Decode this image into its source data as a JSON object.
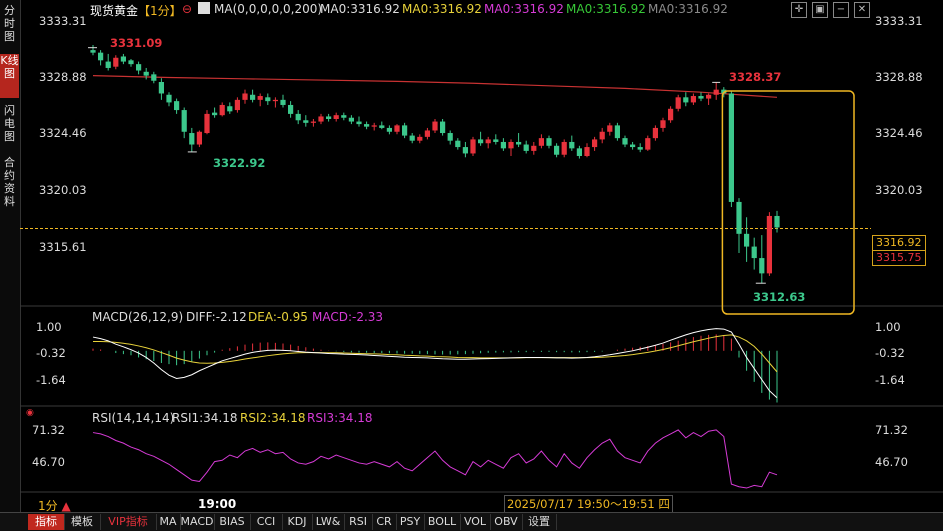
{
  "sidebar": {
    "items": [
      {
        "label": "分时图",
        "active": false
      },
      {
        "label": "K线图",
        "active": true
      },
      {
        "label": "闪电图",
        "active": false
      },
      {
        "label": "合约资料",
        "active": false
      }
    ]
  },
  "header": {
    "title": "现货黄金",
    "period": "【1分】",
    "collapse_icon": "circle-minus-icon",
    "ma_params": "MA(0,0,0,0,0,200)",
    "ma_values": [
      {
        "text": "MA0:3316.92",
        "color": "#dddddd"
      },
      {
        "text": "MA0:3316.92",
        "color": "#e8d23a"
      },
      {
        "text": "MA0:3316.92",
        "color": "#d63bd6"
      },
      {
        "text": "MA0:3316.92",
        "color": "#37c837"
      },
      {
        "text": "MA0:3316.92",
        "color": "#8a8a8a"
      }
    ],
    "tools": [
      "cross-icon",
      "frame-icon",
      "minus-icon",
      "close-icon"
    ]
  },
  "price_axis": [
    "3333.31",
    "3328.88",
    "3324.46",
    "3320.03",
    "3315.61"
  ],
  "price_tags": {
    "current": "3316.92",
    "second": "3315.75"
  },
  "annotations": {
    "high_left": "3331.09",
    "low_left": "3322.92",
    "high_right": "3328.37",
    "low_right": "3312.63"
  },
  "macd": {
    "label": "MACD(26,12,9)",
    "diff": "DIFF:-2.12",
    "dea": "DEA:-0.95",
    "macd": "MACD:-2.33",
    "axis": [
      "1.00",
      "-0.32",
      "-1.64"
    ]
  },
  "rsi": {
    "label": "RSI(14,14,14)",
    "rsi1": "RSI1:34.18",
    "rsi2": "RSI2:34.18",
    "rsi3": "RSI3:34.18",
    "axis": [
      "71.32",
      "46.70"
    ]
  },
  "footer": {
    "period_label": "1分",
    "time_label": "19:00",
    "range_label": "2025/07/17 19:50～19:51 四"
  },
  "bottom_tabs": [
    "指标",
    "模板",
    "VIP指标",
    "MA",
    "MACD",
    "BIAS",
    "CCI",
    "KDJ",
    "LW&",
    "RSI",
    "CR",
    "PSY",
    "BOLL",
    "VOL",
    "OBV",
    "设置"
  ],
  "colors": {
    "up": "#e8323c",
    "down": "#3cc88c",
    "highlight": "#f0b823",
    "ma200": "#c83232",
    "dea": "#e8d23a",
    "rsi": "#d63bd6"
  },
  "chart_data": {
    "type": "candlestick",
    "price_range": [
      3311.0,
      3334.2
    ],
    "candles": [
      [
        3330.9,
        3331.3,
        3330.5,
        3330.7
      ],
      [
        3330.7,
        3330.9,
        3329.7,
        3330.1
      ],
      [
        3330.0,
        3330.6,
        3329.3,
        3329.5
      ],
      [
        3329.6,
        3330.5,
        3329.4,
        3330.3
      ],
      [
        3330.4,
        3330.6,
        3329.8,
        3330.0
      ],
      [
        3330.1,
        3330.2,
        3329.6,
        3329.8
      ],
      [
        3329.8,
        3330.0,
        3329.0,
        3329.3
      ],
      [
        3329.2,
        3329.5,
        3328.6,
        3328.9
      ],
      [
        3329.0,
        3329.2,
        3328.3,
        3328.5
      ],
      [
        3328.4,
        3328.7,
        3327.0,
        3327.5
      ],
      [
        3327.4,
        3327.6,
        3326.5,
        3326.8
      ],
      [
        3326.9,
        3327.1,
        3325.9,
        3326.2
      ],
      [
        3326.2,
        3326.4,
        3324.0,
        3324.5
      ],
      [
        3324.4,
        3324.8,
        3322.9,
        3323.5
      ],
      [
        3323.5,
        3324.6,
        3323.3,
        3324.5
      ],
      [
        3324.4,
        3326.2,
        3324.3,
        3325.9
      ],
      [
        3326.0,
        3326.4,
        3325.6,
        3325.8
      ],
      [
        3325.8,
        3326.8,
        3325.7,
        3326.6
      ],
      [
        3326.5,
        3326.8,
        3325.9,
        3326.1
      ],
      [
        3326.2,
        3327.2,
        3326.0,
        3327.0
      ],
      [
        3327.0,
        3327.8,
        3326.7,
        3327.5
      ],
      [
        3327.4,
        3327.8,
        3326.8,
        3327.0
      ],
      [
        3327.0,
        3327.5,
        3326.5,
        3327.3
      ],
      [
        3327.2,
        3327.5,
        3326.6,
        3326.9
      ],
      [
        3326.9,
        3327.2,
        3326.4,
        3327.0
      ],
      [
        3327.0,
        3327.4,
        3326.4,
        3326.6
      ],
      [
        3326.6,
        3326.9,
        3325.6,
        3325.9
      ],
      [
        3325.9,
        3326.2,
        3325.1,
        3325.4
      ],
      [
        3325.4,
        3325.8,
        3324.9,
        3325.2
      ],
      [
        3325.2,
        3325.5,
        3324.9,
        3325.3
      ],
      [
        3325.3,
        3325.9,
        3325.1,
        3325.7
      ],
      [
        3325.7,
        3325.9,
        3325.3,
        3325.5
      ],
      [
        3325.5,
        3326.0,
        3325.3,
        3325.8
      ],
      [
        3325.8,
        3326.0,
        3325.4,
        3325.6
      ],
      [
        3325.6,
        3325.8,
        3325.1,
        3325.3
      ],
      [
        3325.3,
        3325.7,
        3324.9,
        3325.1
      ],
      [
        3325.1,
        3325.3,
        3324.7,
        3324.9
      ],
      [
        3324.9,
        3325.2,
        3324.6,
        3325.0
      ],
      [
        3325.0,
        3325.3,
        3324.7,
        3324.8
      ],
      [
        3324.8,
        3325.0,
        3324.3,
        3324.5
      ],
      [
        3324.5,
        3325.1,
        3324.3,
        3325.0
      ],
      [
        3325.0,
        3325.2,
        3324.0,
        3324.2
      ],
      [
        3324.2,
        3324.4,
        3323.6,
        3323.8
      ],
      [
        3323.8,
        3324.3,
        3323.6,
        3324.1
      ],
      [
        3324.1,
        3324.8,
        3323.9,
        3324.6
      ],
      [
        3324.6,
        3325.5,
        3324.4,
        3325.3
      ],
      [
        3325.3,
        3325.5,
        3324.2,
        3324.4
      ],
      [
        3324.4,
        3324.6,
        3323.5,
        3323.8
      ],
      [
        3323.8,
        3324.0,
        3323.1,
        3323.3
      ],
      [
        3323.3,
        3323.7,
        3322.5,
        3322.8
      ],
      [
        3322.8,
        3324.1,
        3322.6,
        3323.9
      ],
      [
        3323.9,
        3324.5,
        3323.4,
        3323.6
      ],
      [
        3323.6,
        3324.1,
        3323.2,
        3323.9
      ],
      [
        3323.9,
        3324.3,
        3323.5,
        3323.7
      ],
      [
        3323.7,
        3324.0,
        3323.0,
        3323.2
      ],
      [
        3323.2,
        3323.9,
        3322.6,
        3323.7
      ],
      [
        3323.7,
        3324.4,
        3323.3,
        3323.5
      ],
      [
        3323.5,
        3323.8,
        3322.8,
        3323.0
      ],
      [
        3323.0,
        3323.7,
        3322.7,
        3323.4
      ],
      [
        3323.4,
        3324.3,
        3323.2,
        3324.0
      ],
      [
        3324.0,
        3324.2,
        3323.2,
        3323.4
      ],
      [
        3323.4,
        3323.6,
        3322.5,
        3322.7
      ],
      [
        3322.7,
        3323.9,
        3322.5,
        3323.7
      ],
      [
        3323.7,
        3324.2,
        3323.0,
        3323.2
      ],
      [
        3323.2,
        3323.4,
        3322.4,
        3322.6
      ],
      [
        3322.6,
        3323.6,
        3322.5,
        3323.3
      ],
      [
        3323.3,
        3324.1,
        3323.0,
        3323.9
      ],
      [
        3323.9,
        3324.8,
        3323.6,
        3324.5
      ],
      [
        3324.5,
        3325.2,
        3324.2,
        3325.0
      ],
      [
        3325.0,
        3325.2,
        3323.8,
        3324.0
      ],
      [
        3324.0,
        3324.2,
        3323.3,
        3323.5
      ],
      [
        3323.5,
        3323.7,
        3323.1,
        3323.3
      ],
      [
        3323.3,
        3323.6,
        3322.9,
        3323.1
      ],
      [
        3323.1,
        3324.2,
        3323.0,
        3324.0
      ],
      [
        3324.0,
        3325.0,
        3323.8,
        3324.8
      ],
      [
        3324.8,
        3325.6,
        3324.5,
        3325.4
      ],
      [
        3325.4,
        3326.5,
        3325.2,
        3326.3
      ],
      [
        3326.3,
        3327.4,
        3326.1,
        3327.2
      ],
      [
        3327.2,
        3327.6,
        3326.5,
        3326.8
      ],
      [
        3326.8,
        3327.5,
        3326.6,
        3327.3
      ],
      [
        3327.3,
        3327.6,
        3326.9,
        3327.1
      ],
      [
        3327.1,
        3327.5,
        3326.6,
        3327.4
      ],
      [
        3327.4,
        3328.4,
        3327.0,
        3327.8
      ],
      [
        3327.8,
        3328.0,
        3327.2,
        3327.5
      ],
      [
        3327.5,
        3327.7,
        3318.6,
        3319.0
      ],
      [
        3319.0,
        3319.3,
        3315.0,
        3316.5
      ],
      [
        3316.5,
        3317.8,
        3314.3,
        3315.5
      ],
      [
        3315.5,
        3316.2,
        3313.7,
        3314.6
      ],
      [
        3314.6,
        3316.4,
        3312.6,
        3313.4
      ],
      [
        3313.4,
        3318.2,
        3313.2,
        3317.9
      ],
      [
        3317.9,
        3318.3,
        3316.6,
        3317.0
      ]
    ],
    "ma200": [
      [
        0,
        3328.9
      ],
      [
        10,
        3328.75
      ],
      [
        20,
        3328.65
      ],
      [
        30,
        3328.55
      ],
      [
        40,
        3328.45
      ],
      [
        50,
        3328.3
      ],
      [
        60,
        3328.1
      ],
      [
        70,
        3327.9
      ],
      [
        80,
        3327.6
      ],
      [
        90,
        3327.2
      ]
    ],
    "macd": {
      "range": [
        -2.4,
        1.3
      ],
      "hist": [
        0.1,
        0.06,
        0.0,
        -0.1,
        -0.15,
        -0.2,
        -0.3,
        -0.38,
        -0.46,
        -0.55,
        -0.6,
        -0.65,
        -0.6,
        -0.5,
        -0.35,
        -0.2,
        -0.08,
        0.05,
        0.12,
        0.2,
        0.28,
        0.33,
        0.37,
        0.38,
        0.36,
        0.33,
        0.28,
        0.22,
        0.16,
        0.1,
        0.05,
        0.01,
        -0.02,
        -0.05,
        -0.07,
        -0.08,
        -0.09,
        -0.1,
        -0.1,
        -0.11,
        -0.12,
        -0.13,
        -0.13,
        -0.14,
        -0.15,
        -0.16,
        -0.17,
        -0.17,
        -0.16,
        -0.15,
        -0.13,
        -0.11,
        -0.09,
        -0.08,
        -0.07,
        -0.07,
        -0.06,
        -0.06,
        -0.05,
        -0.05,
        -0.05,
        -0.06,
        -0.06,
        -0.07,
        -0.07,
        -0.06,
        -0.05,
        -0.03,
        0.0,
        0.05,
        0.1,
        0.14,
        0.18,
        0.22,
        0.26,
        0.31,
        0.38,
        0.46,
        0.55,
        0.62,
        0.68,
        0.72,
        0.74,
        0.7,
        0.55,
        -0.3,
        -0.9,
        -1.4,
        -1.9,
        -2.2,
        -2.33
      ],
      "diff": [
        0.62,
        0.55,
        0.45,
        0.3,
        0.18,
        0.05,
        -0.1,
        -0.3,
        -0.55,
        -0.85,
        -1.1,
        -1.25,
        -1.2,
        -1.08,
        -0.9,
        -0.75,
        -0.6,
        -0.45,
        -0.35,
        -0.25,
        -0.15,
        -0.07,
        -0.02,
        0.02,
        0.03,
        0.02,
        0.0,
        -0.03,
        -0.06,
        -0.08,
        -0.1,
        -0.12,
        -0.13,
        -0.15,
        -0.16,
        -0.17,
        -0.19,
        -0.21,
        -0.23,
        -0.25,
        -0.27,
        -0.29,
        -0.3,
        -0.31,
        -0.32,
        -0.34,
        -0.36,
        -0.37,
        -0.38,
        -0.38,
        -0.37,
        -0.36,
        -0.35,
        -0.34,
        -0.33,
        -0.32,
        -0.31,
        -0.3,
        -0.3,
        -0.3,
        -0.31,
        -0.32,
        -0.32,
        -0.33,
        -0.32,
        -0.3,
        -0.27,
        -0.23,
        -0.18,
        -0.12,
        -0.06,
        0.0,
        0.08,
        0.16,
        0.25,
        0.35,
        0.48,
        0.6,
        0.72,
        0.82,
        0.9,
        0.96,
        1.0,
        0.98,
        0.85,
        0.3,
        -0.3,
        -0.8,
        -1.3,
        -1.8,
        -2.12
      ],
      "dea": [
        0.42,
        0.42,
        0.41,
        0.38,
        0.34,
        0.29,
        0.22,
        0.14,
        0.04,
        -0.08,
        -0.2,
        -0.33,
        -0.42,
        -0.5,
        -0.55,
        -0.56,
        -0.55,
        -0.52,
        -0.48,
        -0.43,
        -0.37,
        -0.32,
        -0.27,
        -0.22,
        -0.18,
        -0.14,
        -0.11,
        -0.09,
        -0.08,
        -0.08,
        -0.08,
        -0.09,
        -0.09,
        -0.1,
        -0.11,
        -0.12,
        -0.13,
        -0.14,
        -0.15,
        -0.17,
        -0.18,
        -0.2,
        -0.21,
        -0.23,
        -0.24,
        -0.26,
        -0.27,
        -0.28,
        -0.3,
        -0.31,
        -0.31,
        -0.32,
        -0.32,
        -0.32,
        -0.32,
        -0.32,
        -0.32,
        -0.31,
        -0.31,
        -0.31,
        -0.31,
        -0.31,
        -0.31,
        -0.31,
        -0.31,
        -0.31,
        -0.3,
        -0.29,
        -0.27,
        -0.24,
        -0.21,
        -0.17,
        -0.12,
        -0.07,
        -0.01,
        0.06,
        0.14,
        0.23,
        0.32,
        0.41,
        0.49,
        0.57,
        0.64,
        0.69,
        0.72,
        0.62,
        0.45,
        0.2,
        -0.15,
        -0.55,
        -0.95
      ]
    },
    "rsi": {
      "range": [
        25,
        78
      ],
      "values": [
        70,
        69,
        67,
        64,
        62,
        59,
        57,
        54,
        52,
        49,
        46,
        42,
        38,
        34,
        33,
        40,
        48,
        49,
        53,
        51,
        56,
        58,
        55,
        57,
        54,
        55,
        50,
        47,
        46,
        48,
        52,
        50,
        53,
        51,
        49,
        47,
        46,
        48,
        46,
        44,
        48,
        43,
        41,
        46,
        51,
        56,
        49,
        44,
        41,
        38,
        48,
        44,
        49,
        46,
        43,
        51,
        54,
        47,
        50,
        56,
        49,
        44,
        54,
        47,
        43,
        51,
        57,
        62,
        65,
        56,
        51,
        49,
        47,
        56,
        62,
        66,
        69,
        72,
        66,
        70,
        67,
        71,
        72,
        67,
        31,
        29,
        28,
        30,
        29,
        40,
        38
      ]
    }
  }
}
